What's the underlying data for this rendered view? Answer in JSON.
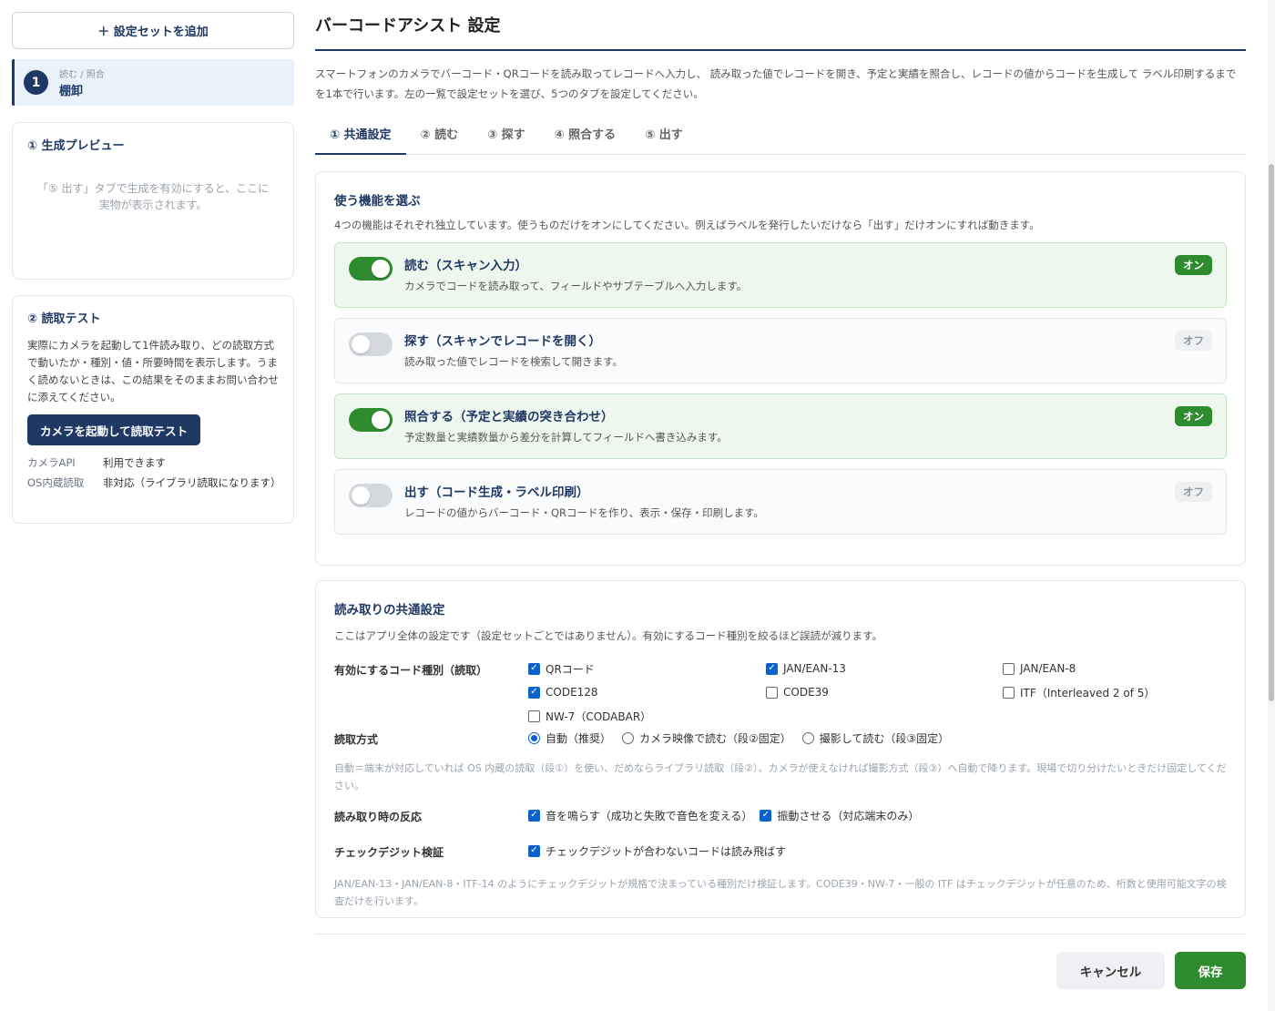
{
  "sidebar": {
    "add_set_label": "＋ 設定セットを追加",
    "current_set": {
      "number": "1",
      "kind": "読む / 照合",
      "name": "棚卸"
    },
    "preview": {
      "title": "① 生成プレビュー",
      "empty_text": "「⑤ 出す」タブで生成を有効にすると、ここに実物が表示されます。"
    },
    "read_test": {
      "title": "② 読取テスト",
      "description": "実際にカメラを起動して1件読み取り、どの読取方式で動いたか・種別・値・所要時間を表示します。うまく読めないときは、この結果をそのままお問い合わせに添えてください。",
      "button_label": "カメラを起動して読取テスト",
      "status": [
        {
          "key": "カメラAPI",
          "value": "利用できます"
        },
        {
          "key": "OS内蔵読取",
          "value": "非対応（ライブラリ読取になります）"
        }
      ]
    }
  },
  "main": {
    "title": "バーコードアシスト 設定",
    "description": "スマートフォンのカメラでバーコード・QRコードを読み取ってレコードへ入力し、 読み取った値でレコードを開き、予定と実績を照合し、レコードの値からコードを生成して ラベル印刷するまでを1本で行います。左の一覧で設定セットを選び、5つのタブを設定してください。",
    "tabs": [
      {
        "label": "① 共通設定",
        "active": true
      },
      {
        "label": "② 読む",
        "active": false
      },
      {
        "label": "③ 探す",
        "active": false
      },
      {
        "label": "④ 照合する",
        "active": false
      },
      {
        "label": "⑤ 出す",
        "active": false
      }
    ],
    "features_section": {
      "title": "使う機能を選ぶ",
      "description": "4つの機能はそれぞれ独立しています。使うものだけをオンにしてください。例えばラベルを発行したいだけなら「出す」だけオンにすれば動きます。",
      "features": [
        {
          "title": "読む（スキャン入力）",
          "description": "カメラでコードを読み取って、フィールドやサブテーブルへ入力します。",
          "on": true,
          "badge": "オン"
        },
        {
          "title": "探す（スキャンでレコードを開く）",
          "description": "読み取った値でレコードを検索して開きます。",
          "on": false,
          "badge": "オフ"
        },
        {
          "title": "照合する（予定と実績の突き合わせ）",
          "description": "予定数量と実績数量から差分を計算してフィールドへ書き込みます。",
          "on": true,
          "badge": "オン"
        },
        {
          "title": "出す（コード生成・ラベル印刷）",
          "description": "レコードの値からバーコード・QRコードを作り、表示・保存・印刷します。",
          "on": false,
          "badge": "オフ"
        }
      ]
    },
    "read_settings": {
      "title": "読み取りの共通設定",
      "description": "ここはアプリ全体の設定です（設定セットごとではありません）。有効にするコード種別を絞るほど誤読が減ります。",
      "code_types_label": "有効にするコード種別（読取）",
      "code_types": [
        {
          "label": "QRコード",
          "checked": true
        },
        {
          "label": "JAN/EAN-13",
          "checked": true
        },
        {
          "label": "JAN/EAN-8",
          "checked": false
        },
        {
          "label": "CODE128",
          "checked": true
        },
        {
          "label": "CODE39",
          "checked": false
        },
        {
          "label": "ITF（Interleaved 2 of 5）",
          "checked": false
        },
        {
          "label": "NW-7（CODABAR）",
          "checked": false
        }
      ],
      "method_label": "読取方式",
      "methods": [
        {
          "label": "自動（推奨）",
          "checked": true
        },
        {
          "label": "カメラ映像で読む（段②固定）",
          "checked": false
        },
        {
          "label": "撮影して読む（段③固定）",
          "checked": false
        }
      ],
      "method_note": "自動＝端末が対応していれば OS 内蔵の読取（段①）を使い、だめならライブラリ読取（段②）、カメラが使えなければ撮影方式（段③）へ自動で降ります。現場で切り分けたいときだけ固定してください。",
      "reaction_label": "読み取り時の反応",
      "reactions": [
        {
          "label": "音を鳴らす（成功と失敗で音色を変える）",
          "checked": true
        },
        {
          "label": "振動させる（対応端末のみ）",
          "checked": true
        }
      ],
      "checkdigit_label": "チェックデジット検証",
      "checkdigit": {
        "label": "チェックデジットが合わないコードは読み飛ばす",
        "checked": true
      },
      "checkdigit_note": "JAN/EAN-13・JAN/EAN-8・ITF-14 のようにチェックデジットが規格で決まっている種別だけ検証します。CODE39・NW-7・一般の ITF はチェックデジットが任意のため、桁数と使用可能文字の検査だけを行います。"
    }
  },
  "footer": {
    "cancel_label": "キャンセル",
    "save_label": "保存"
  },
  "colors": {
    "brand": "#1f3864",
    "on": "#2e8b2e",
    "checkbox": "#0b63c9"
  }
}
